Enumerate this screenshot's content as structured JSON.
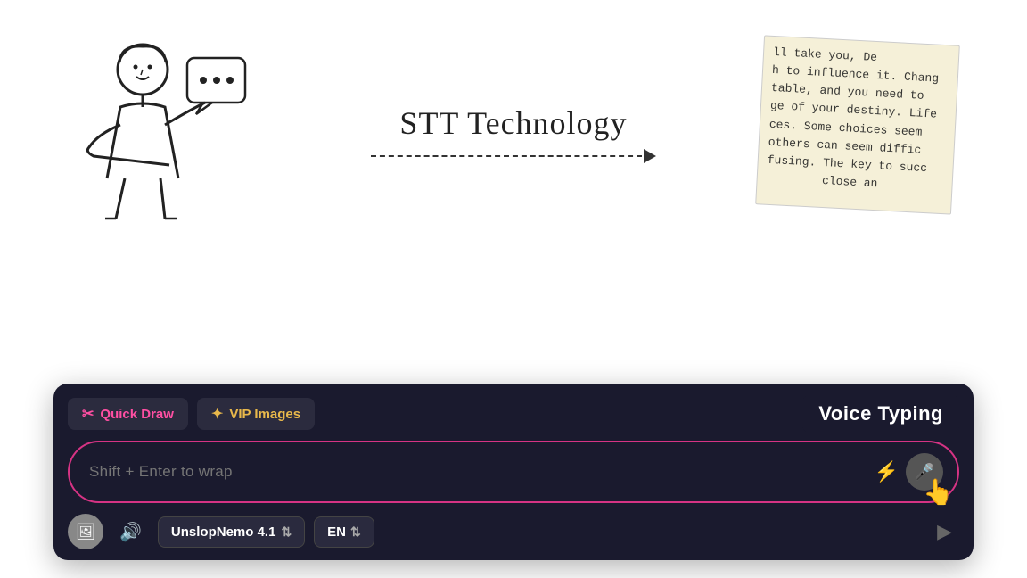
{
  "top": {
    "stt_label": "STT Technology",
    "text_paper_lines": [
      "ll take you, De",
      "h to influence it. Chang",
      "table, and you need to",
      "ge of your destiny. Life",
      "ces. Some choices seem",
      "others can seem diffic",
      "fusing. The key to succ",
      "          close an"
    ]
  },
  "chat_interface": {
    "quick_draw_label": "Quick Draw",
    "vip_images_label": "VIP Images",
    "voice_typing_label": "Voice Typing",
    "input_placeholder": "Shift + Enter to wrap",
    "model_selector_label": "UnslopNemo 4.1",
    "lang_selector_label": "EN",
    "icons": {
      "scissors": "✂",
      "sparkle": "✦",
      "lightning": "⚡",
      "mic": "🎤",
      "image": "🖼",
      "speaker": "🔊",
      "chevron_updown": "⇅",
      "send": "▶"
    }
  }
}
